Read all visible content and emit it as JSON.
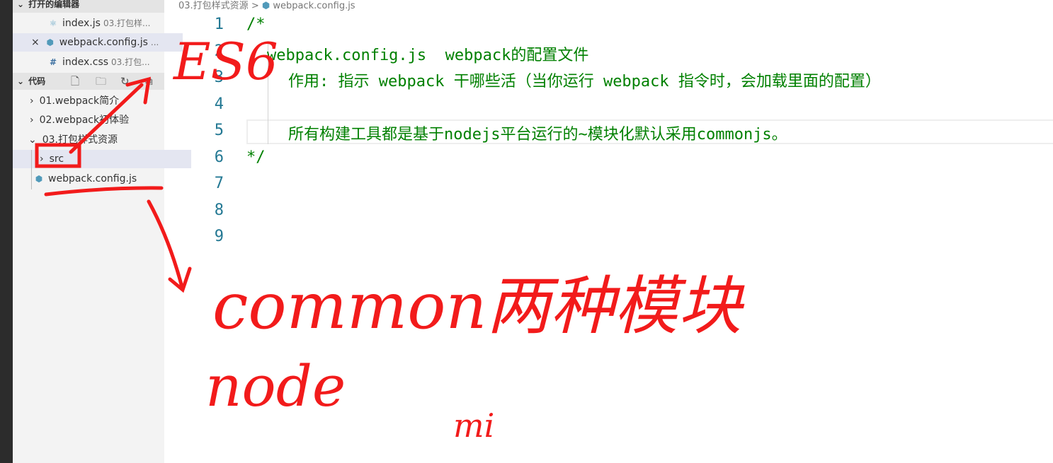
{
  "sidebar": {
    "open_editors": {
      "title": "打开的编辑器",
      "items": [
        {
          "name": "index.js",
          "path": "03.打包样...",
          "icon": "react-icon"
        },
        {
          "name": "webpack.config.js",
          "path": "...",
          "icon": "webpack-icon",
          "close": "×"
        },
        {
          "name": "index.css",
          "path": "03.打包...",
          "icon": "hash-icon"
        }
      ]
    },
    "explorer": {
      "title": "代码",
      "tree": [
        {
          "label": "01.webpack简介",
          "chevron": "›"
        },
        {
          "label": "02.webpack初体验",
          "chevron": "›"
        },
        {
          "label": "03.打包样式资源",
          "chevron": "⌄"
        },
        {
          "label": "src",
          "chevron": "›"
        },
        {
          "label": "webpack.config.js"
        }
      ]
    }
  },
  "breadcrumb": {
    "folder": "03.打包样式资源",
    "sep": ">",
    "file": "webpack.config.js"
  },
  "editor": {
    "lines": [
      {
        "n": "1",
        "text": "/*"
      },
      {
        "n": "2",
        "text": "webpack.config.js  webpack的配置文件"
      },
      {
        "n": "3",
        "text": "作用: 指示 webpack 干哪些活（当你运行 webpack 指令时，会加载里面的配置）"
      },
      {
        "n": "4",
        "text": ""
      },
      {
        "n": "5",
        "text": "所有构建工具都是基于nodejs平台运行的~模块化默认采用commonjs。"
      },
      {
        "n": "6",
        "text": "*/"
      },
      {
        "n": "7",
        "text": ""
      },
      {
        "n": "8",
        "text": ""
      },
      {
        "n": "9",
        "text": ""
      }
    ]
  },
  "annotations": {
    "es6": "ES6",
    "common": "common两种模块",
    "node": "node",
    "mi": "mi"
  }
}
